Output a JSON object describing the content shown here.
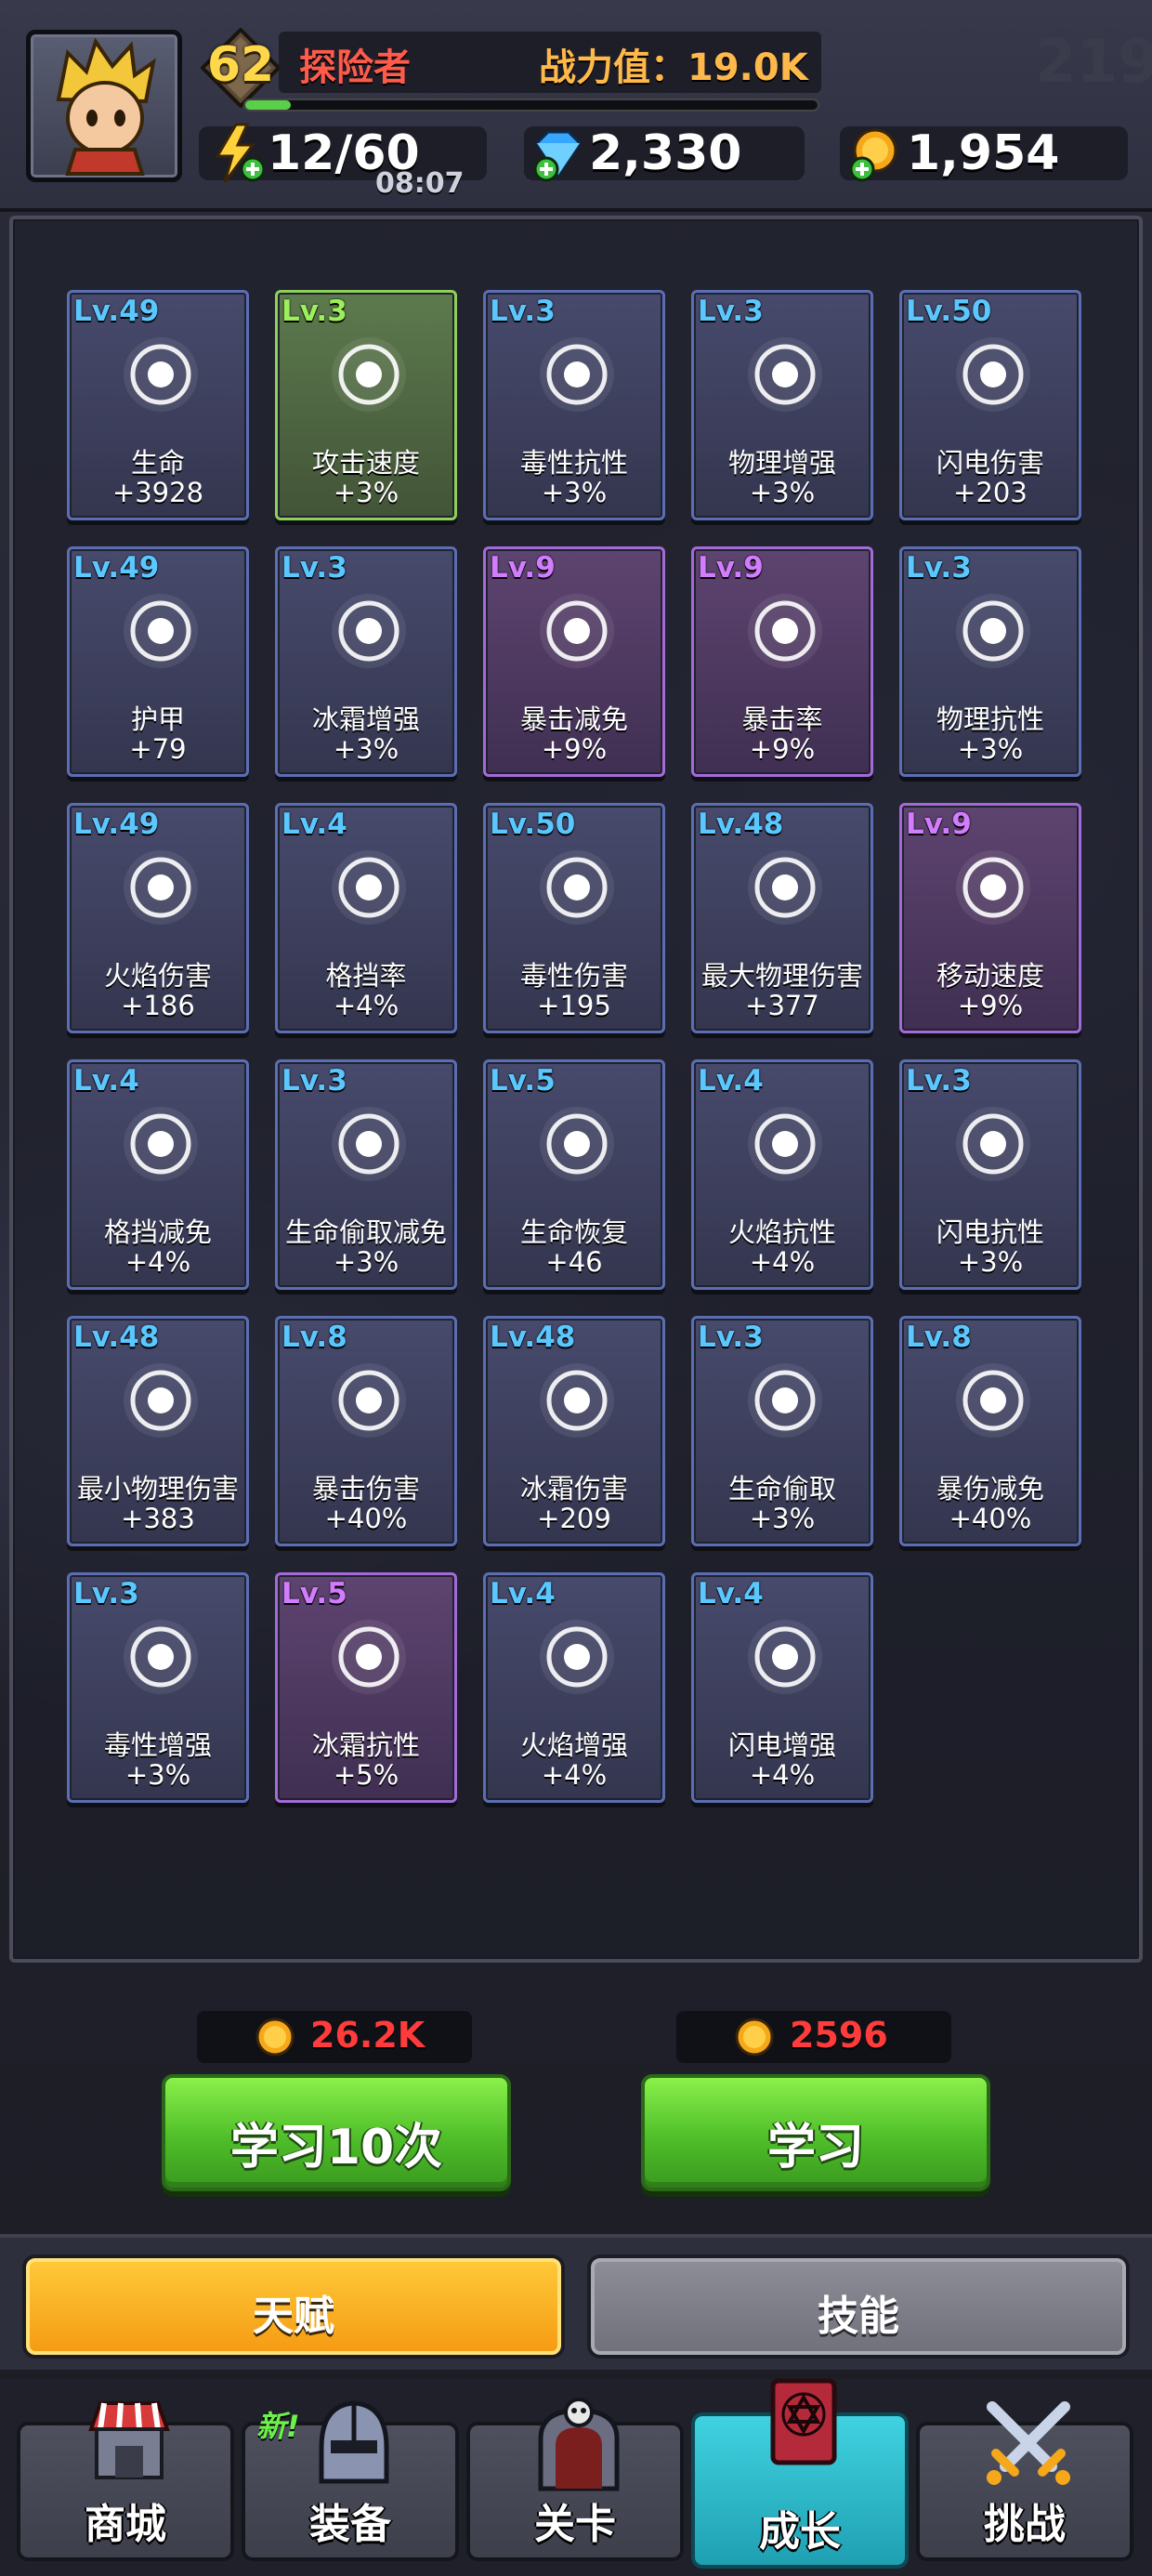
{
  "header": {
    "level": "62",
    "rank": "探险者",
    "power": "战力值：19.0K",
    "xp_fraction": 0.08,
    "energy": "12/60",
    "energy_timer": "08:07",
    "gems": "2,330",
    "coins": "1,954",
    "corner_number": "219"
  },
  "talents": [
    {
      "lv": "Lv.49",
      "name": "生命",
      "val": "+3928",
      "tier": "blue",
      "icon": "drop-icon"
    },
    {
      "lv": "Lv.3",
      "name": "攻击速度",
      "val": "+3%",
      "tier": "green",
      "icon": "blade-icon"
    },
    {
      "lv": "Lv.3",
      "name": "毒性抗性",
      "val": "+3%",
      "tier": "blue",
      "icon": "poison-shield-icon"
    },
    {
      "lv": "Lv.3",
      "name": "物理增强",
      "val": "+3%",
      "tier": "blue",
      "icon": "axe-up-icon"
    },
    {
      "lv": "Lv.50",
      "name": "闪电伤害",
      "val": "+203",
      "tier": "blue",
      "icon": "lightning-circle-icon"
    },
    {
      "lv": "Lv.49",
      "name": "护甲",
      "val": "+79",
      "tier": "blue",
      "icon": "armor-icon"
    },
    {
      "lv": "Lv.3",
      "name": "冰霜增强",
      "val": "+3%",
      "tier": "blue",
      "icon": "snowflake-up-icon"
    },
    {
      "lv": "Lv.9",
      "name": "暴击减免",
      "val": "+9%",
      "tier": "purple",
      "icon": "crit-down-icon"
    },
    {
      "lv": "Lv.9",
      "name": "暴击率",
      "val": "+9%",
      "tier": "purple",
      "icon": "crit-icon"
    },
    {
      "lv": "Lv.3",
      "name": "物理抗性",
      "val": "+3%",
      "tier": "blue",
      "icon": "sword-shield-icon"
    },
    {
      "lv": "Lv.49",
      "name": "火焰伤害",
      "val": "+186",
      "tier": "blue",
      "icon": "fire-circle-icon"
    },
    {
      "lv": "Lv.4",
      "name": "格挡率",
      "val": "+4%",
      "tier": "blue",
      "icon": "shield-circle-icon"
    },
    {
      "lv": "Lv.50",
      "name": "毒性伤害",
      "val": "+195",
      "tier": "blue",
      "icon": "poison-circle-icon"
    },
    {
      "lv": "Lv.48",
      "name": "最大物理伤害",
      "val": "+377",
      "tier": "blue",
      "icon": "sword-icon"
    },
    {
      "lv": "Lv.9",
      "name": "移动速度",
      "val": "+9%",
      "tier": "purple",
      "icon": "boot-icon"
    },
    {
      "lv": "Lv.4",
      "name": "格挡减免",
      "val": "+4%",
      "tier": "blue",
      "icon": "shield-down-icon"
    },
    {
      "lv": "Lv.3",
      "name": "生命偷取减免",
      "val": "+3%",
      "tier": "blue",
      "icon": "vampire-down-icon"
    },
    {
      "lv": "Lv.5",
      "name": "生命恢复",
      "val": "+46",
      "tier": "blue",
      "icon": "drops-icon"
    },
    {
      "lv": "Lv.4",
      "name": "火焰抗性",
      "val": "+4%",
      "tier": "blue",
      "icon": "fire-shield-icon"
    },
    {
      "lv": "Lv.3",
      "name": "闪电抗性",
      "val": "+3%",
      "tier": "blue",
      "icon": "lightning-shield-icon"
    },
    {
      "lv": "Lv.48",
      "name": "最小物理伤害",
      "val": "+383",
      "tier": "blue",
      "icon": "claw-icon"
    },
    {
      "lv": "Lv.8",
      "name": "暴击伤害",
      "val": "+40%",
      "tier": "blue",
      "icon": "fist-burst-icon"
    },
    {
      "lv": "Lv.48",
      "name": "冰霜伤害",
      "val": "+209",
      "tier": "blue",
      "icon": "snowflake-circle-icon"
    },
    {
      "lv": "Lv.3",
      "name": "生命偷取",
      "val": "+3%",
      "tier": "blue",
      "icon": "vampire-icon"
    },
    {
      "lv": "Lv.8",
      "name": "暴伤减免",
      "val": "+40%",
      "tier": "blue",
      "icon": "fist-down-icon"
    },
    {
      "lv": "Lv.3",
      "name": "毒性增强",
      "val": "+3%",
      "tier": "blue",
      "icon": "skull-up-icon"
    },
    {
      "lv": "Lv.5",
      "name": "冰霜抗性",
      "val": "+5%",
      "tier": "purple",
      "icon": "snow-shield-icon"
    },
    {
      "lv": "Lv.4",
      "name": "火焰增强",
      "val": "+4%",
      "tier": "blue",
      "icon": "fire-up-icon"
    },
    {
      "lv": "Lv.4",
      "name": "闪电增强",
      "val": "+4%",
      "tier": "blue",
      "icon": "lightning-up-icon"
    }
  ],
  "learn": {
    "multi_cost": "26.2K",
    "multi_label": "学习10次",
    "single_cost": "2596",
    "single_label": "学习"
  },
  "tabs": {
    "talent": "天赋",
    "skill": "技能"
  },
  "nav": {
    "shop": "商城",
    "equip": "装备",
    "equip_badge": "新!",
    "stage": "关卡",
    "growth": "成长",
    "challenge": "挑战"
  },
  "colors": {
    "blue_border": "#5b6eb3",
    "green_border": "#8fd05a",
    "purple_border": "#a36ad8",
    "level_blue": "#5ac8ff",
    "cost_red": "#ff3b3b",
    "accent_yellow": "#f5a81a"
  }
}
